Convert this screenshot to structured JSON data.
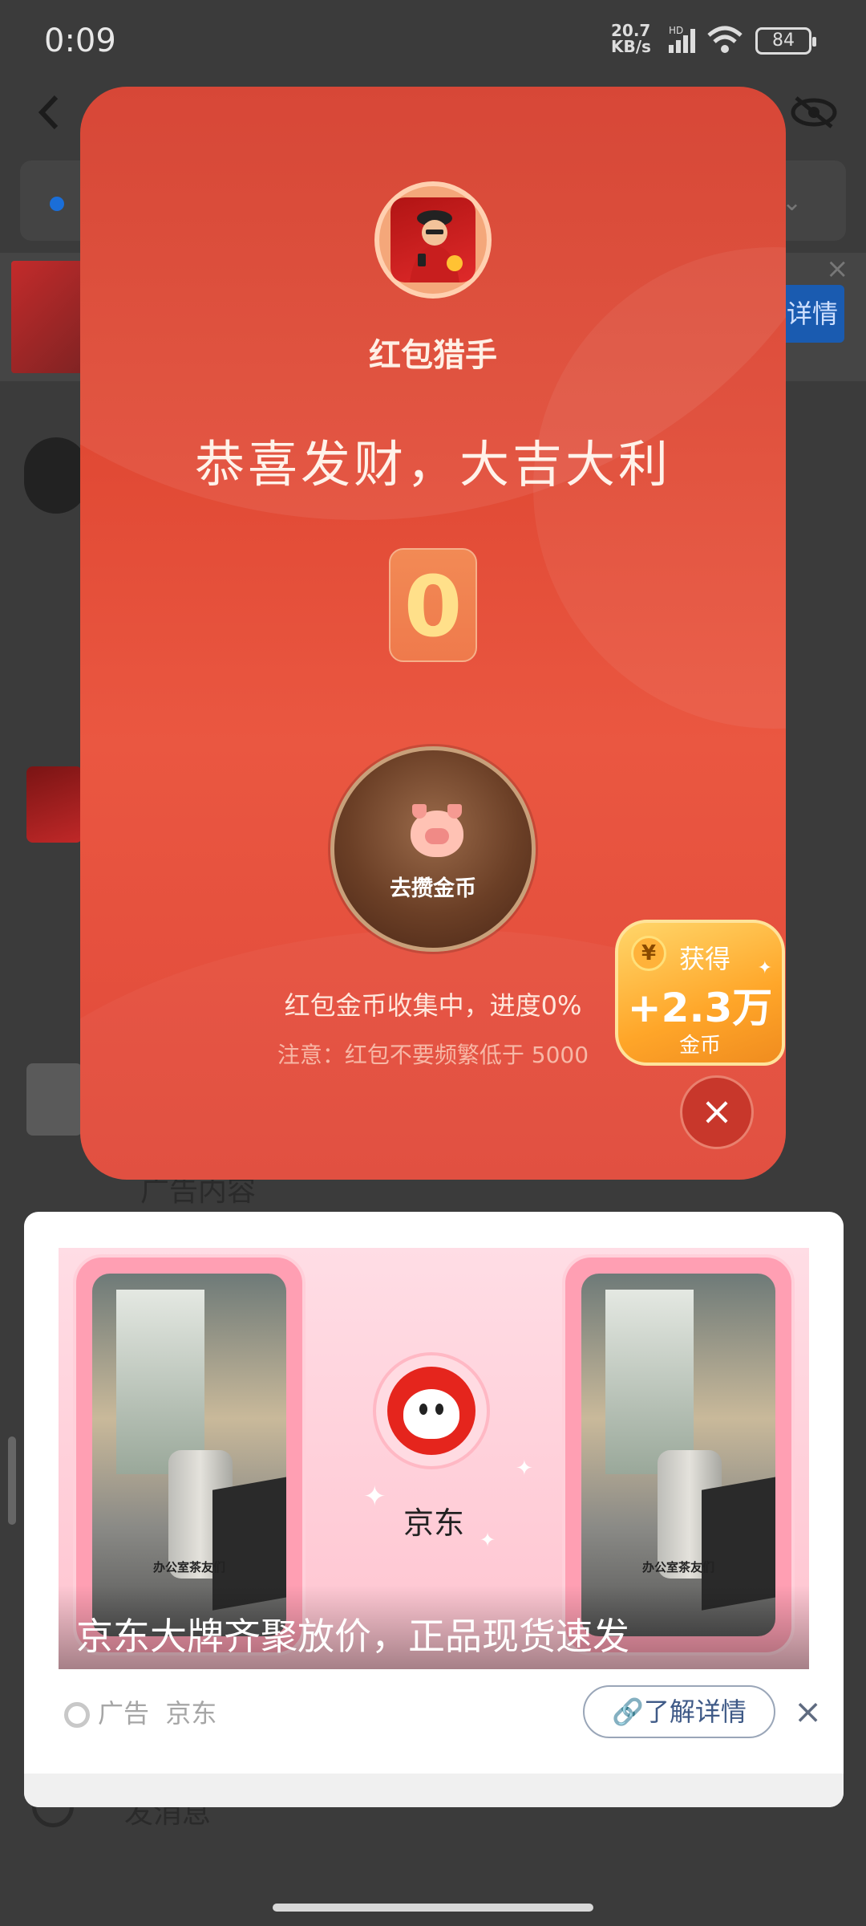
{
  "status_bar": {
    "time": "0:09",
    "net_speed_value": "20.7",
    "net_speed_unit": "KB/s",
    "hd": "HD",
    "battery": "84"
  },
  "background": {
    "detail_label": "详情",
    "ad_content_text": "广告内容",
    "bottom_text": "发消息"
  },
  "envelope": {
    "app_name": "红包猎手",
    "headline": "恭喜发财，大吉大利",
    "counter_value": "0",
    "coin_button_label": "去攒金币",
    "progress_text": "红包金币收集中，进度0%",
    "notice_text": "注意：红包不要频繁低于 5000"
  },
  "reward": {
    "yen": "¥",
    "title": "获得",
    "amount": "+2.3万",
    "unit": "金币"
  },
  "ad": {
    "phone_caption": "办公室茶友们",
    "brand_name": "京东",
    "caption": "京东大牌齐聚放价，正品现货速发",
    "ad_label": "广告",
    "advertiser": "京东",
    "learn_more": "了解详情"
  },
  "icons": {
    "close": "×",
    "back": "‹"
  }
}
